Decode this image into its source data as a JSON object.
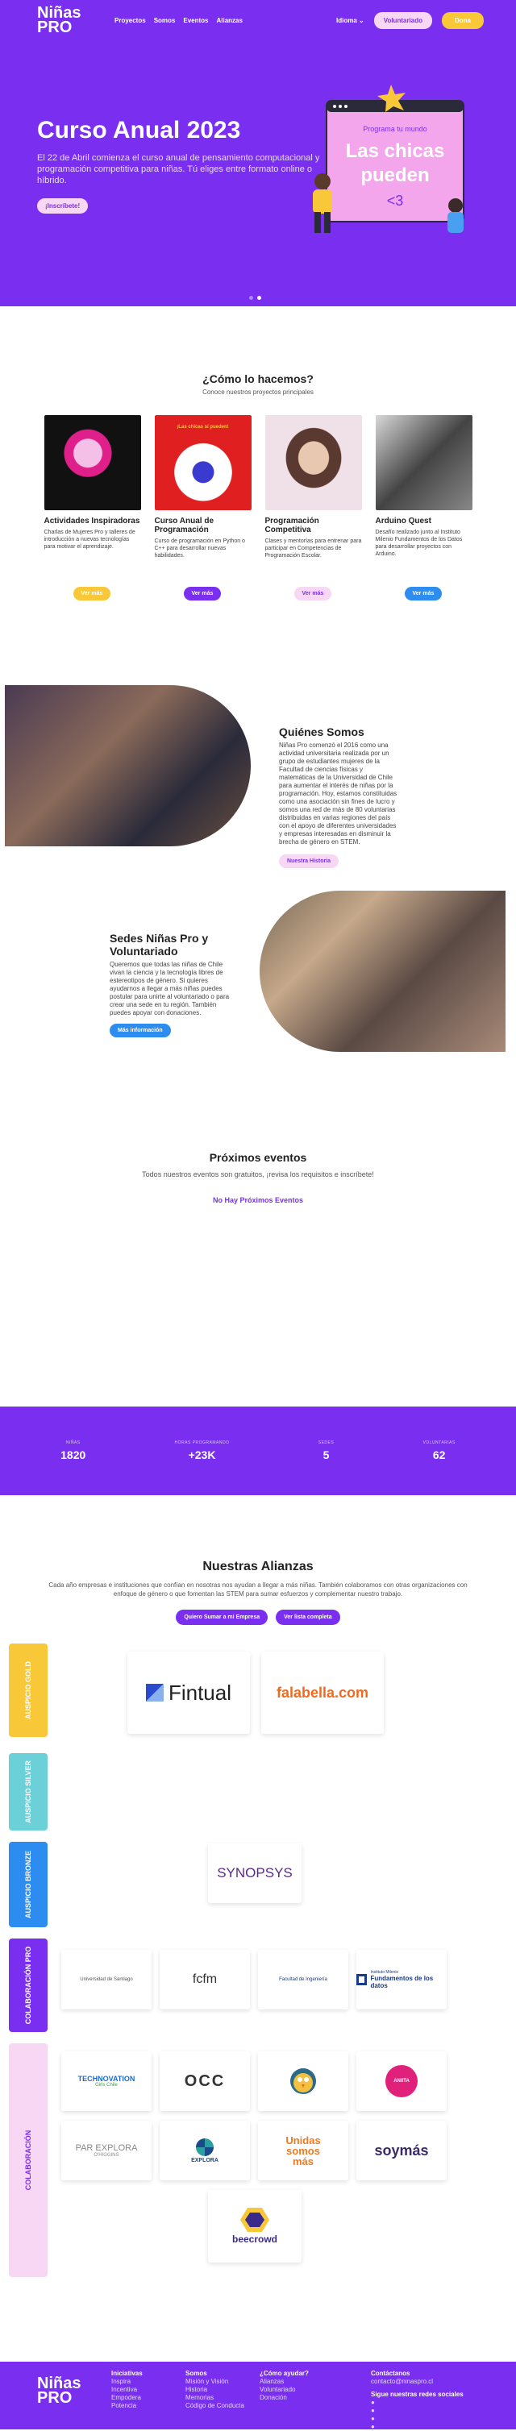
{
  "nav": {
    "logo_line1": "Niñas",
    "logo_line2": "PRO",
    "links": [
      "Proyectos",
      "Somos",
      "Eventos",
      "Alianzas"
    ],
    "language": "Idioma",
    "volunteer": "Voluntariado",
    "donate": "Dona"
  },
  "hero": {
    "title": "Curso Anual 2023",
    "text": "El 22 de Abril comienza el curso anual de pensamiento computacional y programación competitiva para niñas. Tú eliges entre formato online o híbrido.",
    "cta": "¡Inscríbete!",
    "art_small": "Programa tu mundo",
    "art_big1": "Las chicas",
    "art_big2": "pueden",
    "art_heart": "<3"
  },
  "como": {
    "title": "¿Cómo lo hacemos?",
    "subtitle": "Conoce nuestros proyectos principales",
    "cards": [
      {
        "title": "Actividades Inspiradoras",
        "text": "Charlas de Mujeres Pro y talleres de introducción a nuevas tecnologías para motivar el aprendizaje.",
        "button": "Ver más",
        "img_text": "",
        "color": "#f9c838",
        "text_color": "#fff"
      },
      {
        "title": "Curso Anual de Programación",
        "text": "Curso de programación en Python o C++ para desarrollar nuevas habilidades.",
        "button": "Ver más",
        "img_text": "¡Las chicas sí pueden!",
        "color": "#7a2ff0",
        "text_color": "#fff"
      },
      {
        "title": "Programación Competitiva",
        "text": "Clases y mentorías para entrenar para participar en Competencias de Programación Escolar.",
        "button": "Ver más",
        "img_text": "",
        "color": "#f8d7f4",
        "text_color": "#7a2ff0"
      },
      {
        "title": "Arduino Quest",
        "text": "Desafío realizado junto al Instituto Milenio Fundamentos de los Datos para desarrollar proyectos con Arduino.",
        "button": "Ver más",
        "img_text": "",
        "color": "#2d8cf0",
        "text_color": "#fff"
      }
    ]
  },
  "quienes": {
    "title": "Quiénes Somos",
    "text": "Niñas Pro comenzó el 2016 como una actividad universitaria realizada por un grupo de estudiantes mujeres de la Facultad de ciencias físicas y matemáticas de la Universidad de Chile para aumentar el interés de niñas por la programación. Hoy, estamos constituidas como una asociación sin fines de lucro y somos una red de más de 80 voluntarias distribuidas en varias regiones del país con el apoyo de diferentes universidades y empresas interesadas en disminuir la brecha de género en STEM.",
    "button": "Nuestra Historia"
  },
  "sedes": {
    "title": "Sedes Niñas Pro y Voluntariado",
    "text": "Queremos que todas las niñas de Chile vivan la ciencia y la tecnología libres de estereotipos de género. Si quieres ayudarnos a llegar a más niñas puedes postular para unirte al voluntariado o para crear una sede en tu región. También puedes apoyar con donaciones.",
    "button": "Más información"
  },
  "eventos": {
    "title": "Próximos eventos",
    "subtitle": "Todos nuestros eventos son gratuitos, ¡revisa los requisitos e inscríbete!",
    "empty": "No Hay Próximos Eventos"
  },
  "stats": [
    {
      "label": "NIÑAS",
      "value": "1820"
    },
    {
      "label": "HORAS PROGRAMANDO",
      "value": "+23K"
    },
    {
      "label": "SEDES",
      "value": "5"
    },
    {
      "label": "VOLUNTARIAS",
      "value": "62"
    }
  ],
  "alianzas": {
    "title": "Nuestras Alianzas",
    "text": "Cada año empresas e instituciones que confían en nosotras nos ayudan a llegar a más niñas. También colaboramos con otras organizaciones con enfoque de género o que fomentan las STEM para sumar esfuerzos y complementar nuestro trabajo.",
    "btn1": "Quiero Sumar a mi Empresa",
    "btn2": "Ver lista completa",
    "tiers": [
      {
        "label": "AUSPICIO GOLD",
        "color": "#f9c838"
      },
      {
        "label": "AUSPICIO SILVER",
        "color": "#6cd0d8"
      },
      {
        "label": "AUSPICIO BRONZE",
        "color": "#2d8cf0"
      },
      {
        "label": "COLABORACIÓN PRO",
        "color": "#7a2ff0"
      },
      {
        "label": "COLABORACIÓN",
        "color": "#f8d7f4"
      }
    ],
    "logos": {
      "fintual": "Fintual",
      "falabella": "falabella.com",
      "synopsys": "SYNOPSYS",
      "usach": "Universidad de Santiago",
      "fcfm": "fcfm",
      "ing_udp": "Facultad de Ingeniería",
      "imfd": "Fundamentos de los datos",
      "imfd_small": "Instituto Milenio",
      "technovation": "TECHNOVATION",
      "technovation_sub": "Girls Chile",
      "occ": "OCC",
      "aniita": "ANIITA",
      "parexplora": "PAR EXPLORA",
      "parexplora_sub": "O'HIGGINS",
      "explora": "EXPLORA",
      "unidas1": "Unidas",
      "unidas2": "somos",
      "unidas3": "más",
      "soymas": "soymás",
      "beecrowd": "beecrowd"
    }
  },
  "footer": {
    "cols": [
      {
        "title": "Iniciativas",
        "items": [
          "Inspira",
          "Incentiva",
          "Empodera",
          "Potencia"
        ]
      },
      {
        "title": "Somos",
        "items": [
          "Misión y Visión",
          "Historia",
          "Memorias",
          "Código de Conducta"
        ]
      },
      {
        "title": "¿Cómo ayudar?",
        "items": [
          "Alianzas",
          "Voluntariado",
          "Donación"
        ]
      },
      {
        "title": "Contáctanos",
        "items": [
          "contacto@ninaspro.cl"
        ],
        "social": "Sigue nuestras redes sociales"
      }
    ]
  }
}
